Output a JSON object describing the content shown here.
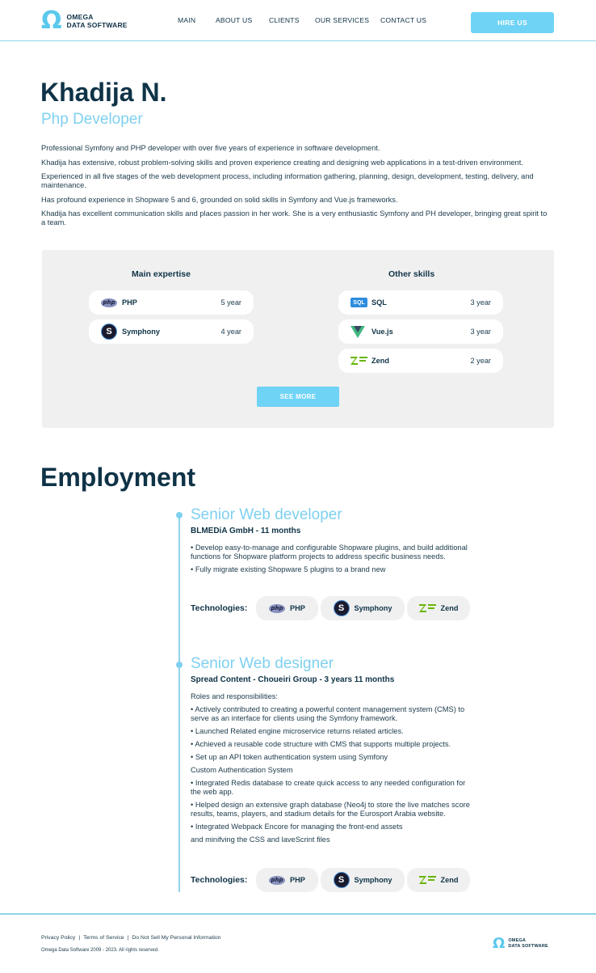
{
  "brand": {
    "line1": "OMEGA",
    "line2": "DATA SOFTWARE",
    "symbol": "Ω"
  },
  "nav": [
    "MAIN",
    "ABOUT US",
    "CLIENTS",
    "OUR SERVICES",
    "CONTACT US"
  ],
  "hire_label": "HIRE US",
  "profile": {
    "name": "Khadija N.",
    "role": "Php Developer",
    "bio": [
      "Professional Symfony and PHP developer with over five years of experience in software development.",
      "Khadija has extensive, robust problem-solving skills and proven experience creating and designing web applications in a test-driven environment.",
      "Experienced in all five stages of the web development process, including information gathering, planning, design, development, testing, delivery, and maintenance.",
      "Has profound experience in Shopware 5 and 6, grounded on solid skills in Symfony and Vue.js frameworks.",
      "Khadija has excellent communication skills and places passion in her work. She is a very enthusiastic Symfony and PH developer, bringing great spirit to a team."
    ]
  },
  "skills": {
    "main_heading": "Main expertise",
    "other_heading": "Other skills",
    "main": [
      {
        "icon": "php-icon",
        "name": "PHP",
        "years": "5 year"
      },
      {
        "icon": "symfony-icon",
        "name": "Symphony",
        "years": "4 year"
      }
    ],
    "other": [
      {
        "icon": "sql-icon",
        "name": "SQL",
        "years": "3 year"
      },
      {
        "icon": "vue-icon",
        "name": "Vue.js",
        "years": "3 year"
      },
      {
        "icon": "zend-icon",
        "name": "Zend",
        "years": "2 year"
      }
    ],
    "see_more": "SEE MORE"
  },
  "employment": {
    "heading": "Employment",
    "jobs": [
      {
        "title": "Senior Web developer",
        "company": "BLMEDiA GmbH - 11 months",
        "details": [
          "• Develop easy-to-manage and configurable Shopware plugins, and build additional functions for Shopware platform projects to address specific business needs.",
          "• Fully migrate existing Shopware 5 plugins to a brand new"
        ],
        "tech_label": "Technologies:",
        "tech": [
          "PHP",
          "Symphony",
          "Zend"
        ]
      },
      {
        "title": "Senior Web designer",
        "company": "Spread Content - Choueiri Group - 3 years 11 months",
        "details": [
          "Roles and responsibilities:",
          "• Actively contributed to creating a powerful content management system (CMS) to serve as an interface for clients using the Symfony framework.",
          "• Launched Related engine microservice returns related articles.",
          "• Achieved a reusable code structure with CMS that supports multiple projects.",
          "• Set up an API token authentication system using Symfony",
          "Custom Authentication System",
          "• Integrated Redis database to create quick access to any needed configuration for the web app.",
          "• Helped design an extensive graph database (Neo4j to store the live matches score results, teams, players, and stadium details for the Eurosport Arabia website.",
          "• Integrated Webpack Encore for managing the front-end assets",
          "and minifving the CSS and laveScrint files"
        ],
        "tech_label": "Technologies:",
        "tech": [
          "PHP",
          "Symphony",
          "Zend"
        ]
      }
    ]
  },
  "footer": {
    "links": [
      "Privacy Policy",
      "|",
      "Terms of Service",
      "|",
      "Do Not Sell My Personal Information"
    ],
    "copyright": "Omega Data Software 2009 - 2023. All rights reserved."
  },
  "colors": {
    "accent": "#6fd3f5",
    "dark": "#0f3347",
    "panel": "#f0f0f0"
  }
}
